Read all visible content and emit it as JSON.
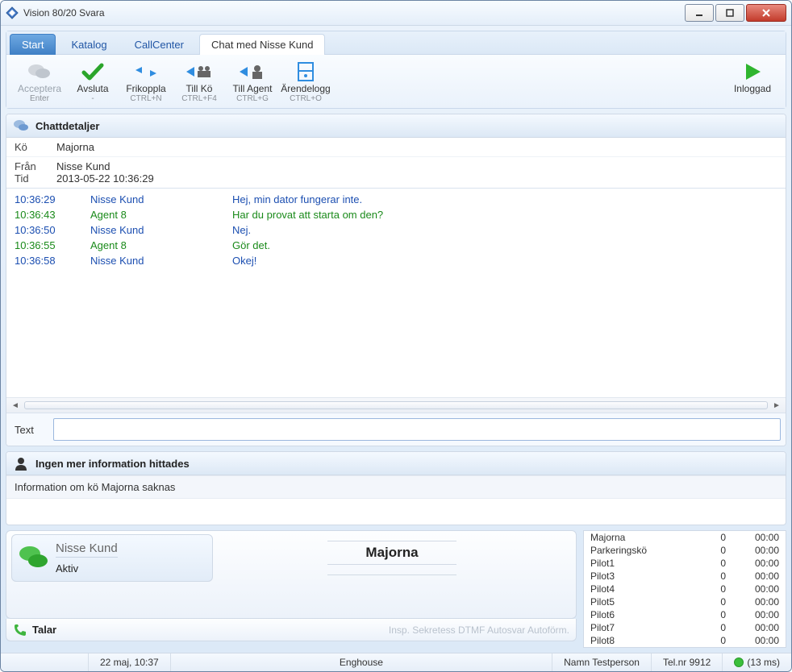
{
  "window": {
    "title": "Vision 80/20 Svara"
  },
  "tabs": [
    {
      "label": "Start",
      "active": false,
      "start": true
    },
    {
      "label": "Katalog"
    },
    {
      "label": "CallCenter"
    },
    {
      "label": "Chat med  Nisse Kund",
      "active": true
    }
  ],
  "ribbon": {
    "acceptera": {
      "label": "Acceptera",
      "sub": "Enter",
      "disabled": true
    },
    "avsluta": {
      "label": "Avsluta",
      "sub": "-"
    },
    "frikoppla": {
      "label": "Frikoppla",
      "sub": "CTRL+N"
    },
    "tillko": {
      "label": "Till Kö",
      "sub": "CTRL+F4"
    },
    "tillagent": {
      "label": "Till Agent",
      "sub": "CTRL+G"
    },
    "arendelogg": {
      "label": "Ärendelogg",
      "sub": "CTRL+O"
    },
    "inloggad": {
      "label": "Inloggad"
    }
  },
  "details": {
    "header": "Chattdetaljer",
    "ko_label": "Kö",
    "ko_value": "Majorna",
    "fran_label": "Från",
    "fran_value": "Nisse Kund",
    "tid_label": "Tid",
    "tid_value": "2013-05-22 10:36:29"
  },
  "chat": [
    {
      "t": "10:36:29",
      "name": "Nisse Kund",
      "msg": "Hej, min dator fungerar inte.",
      "role": "cust"
    },
    {
      "t": "10:36:43",
      "name": "Agent 8",
      "msg": "Har du provat att starta om den?",
      "role": "agent"
    },
    {
      "t": "10:36:50",
      "name": "Nisse Kund",
      "msg": "Nej.",
      "role": "cust"
    },
    {
      "t": "10:36:55",
      "name": "Agent 8",
      "msg": "Gör det.",
      "role": "agent"
    },
    {
      "t": "10:36:58",
      "name": "Nisse Kund",
      "msg": "Okej!",
      "role": "cust"
    }
  ],
  "text_entry": {
    "label": "Text",
    "value": ""
  },
  "info": {
    "header": "Ingen mer information hittades",
    "sub": "Information om kö Majorna saknas"
  },
  "callcard": {
    "name": "Nisse Kund",
    "status": "Aktiv"
  },
  "center_title": "Majorna",
  "speak": {
    "label": "Talar",
    "opts": "Insp.  Sekretess  DTMF  Autosvar  Autoförm."
  },
  "queues": [
    {
      "name": "Majorna",
      "count": "0",
      "time": "00:00"
    },
    {
      "name": "Parkeringskö",
      "count": "0",
      "time": "00:00"
    },
    {
      "name": "Pilot1",
      "count": "0",
      "time": "00:00"
    },
    {
      "name": "Pilot3",
      "count": "0",
      "time": "00:00"
    },
    {
      "name": "Pilot4",
      "count": "0",
      "time": "00:00"
    },
    {
      "name": "Pilot5",
      "count": "0",
      "time": "00:00"
    },
    {
      "name": "Pilot6",
      "count": "0",
      "time": "00:00"
    },
    {
      "name": "Pilot7",
      "count": "0",
      "time": "00:00"
    },
    {
      "name": "Pilot8",
      "count": "0",
      "time": "00:00"
    }
  ],
  "statusbar": {
    "date": "22 maj,  10:37",
    "company": "Enghouse",
    "user": "Namn Testperson",
    "tel": "Tel.nr 9912",
    "ping": "(13 ms)"
  }
}
